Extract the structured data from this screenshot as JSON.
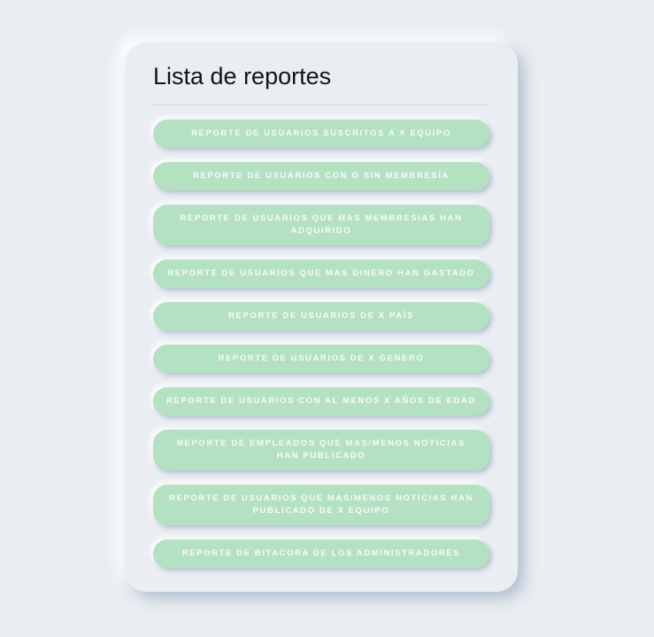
{
  "card": {
    "title": "Lista de reportes"
  },
  "reports": [
    {
      "label": "Reporte de usuarios suscritos a X equipo"
    },
    {
      "label": "Reporte de usuarios con o sin membresía"
    },
    {
      "label": "Reporte de usuarios que mas membresias han adquirido"
    },
    {
      "label": "Reporte de usuarios que mas dinero han gastado"
    },
    {
      "label": "Reporte de usuarios de X país"
    },
    {
      "label": "Reporte de usuarios de X genero"
    },
    {
      "label": "Reporte de usuarios con al menos X años de edad"
    },
    {
      "label": "Reporte de empleados que mas/menos noticias han publicado"
    },
    {
      "label": "Reporte de usuarios que mas/menos noticias han publicado de X equipo"
    },
    {
      "label": "Reporte de bitacora de los administradores"
    }
  ],
  "colors": {
    "background": "#eaeef2",
    "button": "#b5e1c3",
    "button_text": "#f7fbf8",
    "title": "#111418"
  }
}
